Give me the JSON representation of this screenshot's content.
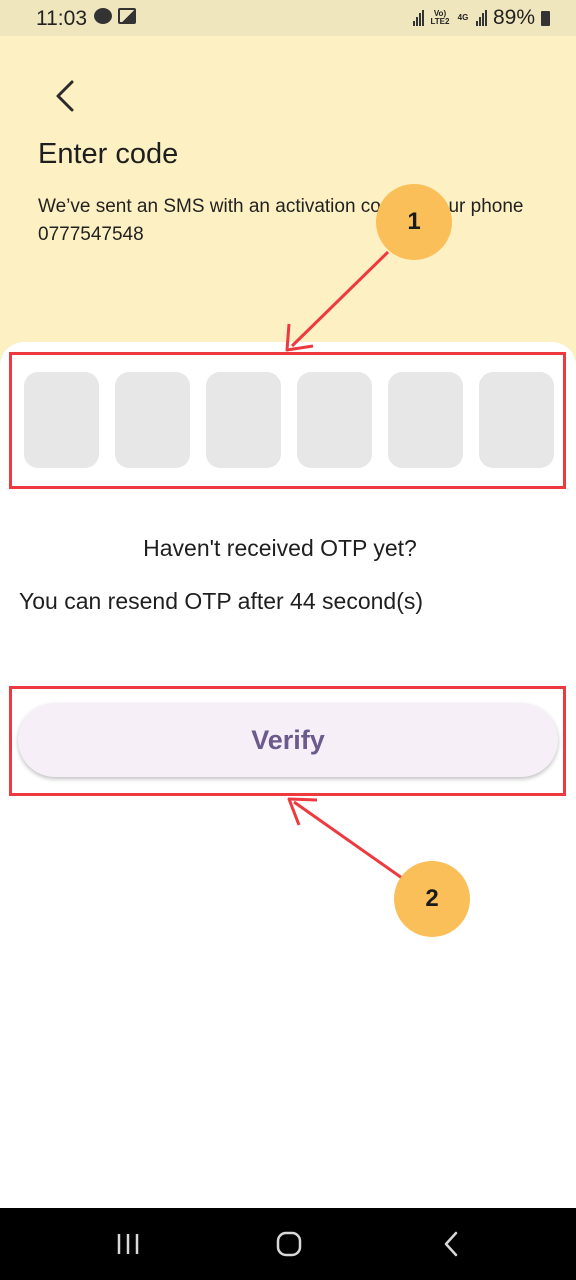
{
  "status_bar": {
    "time": "11:03",
    "battery": "89%",
    "network_labels": [
      "Vo) LTE2",
      "4G"
    ],
    "icons": [
      "chat-icon",
      "image-icon",
      "signal-icon",
      "battery-icon"
    ]
  },
  "header": {
    "title": "Enter code",
    "subtitle": "We’ve sent an SMS with an activation code to your phone 0777547548"
  },
  "otp": {
    "box_count": 6,
    "values": [
      "",
      "",
      "",
      "",
      "",
      ""
    ]
  },
  "resend": {
    "question": "Haven't received OTP yet?",
    "countdown": "You can resend OTP after 44 second(s)"
  },
  "actions": {
    "verify_label": "Verify"
  },
  "annotations": {
    "badge_1": "1",
    "badge_2": "2",
    "highlight_color": "#ee3a3f",
    "badge_color": "#fbbf59"
  },
  "colors": {
    "header_bg": "#fdf0c2",
    "otp_box_bg": "#e7e7e7",
    "verify_bg": "#f6eff8",
    "verify_text": "#6b5a8c"
  },
  "nav_bar": {
    "icons": [
      "recent-apps-icon",
      "home-icon",
      "back-icon"
    ]
  }
}
